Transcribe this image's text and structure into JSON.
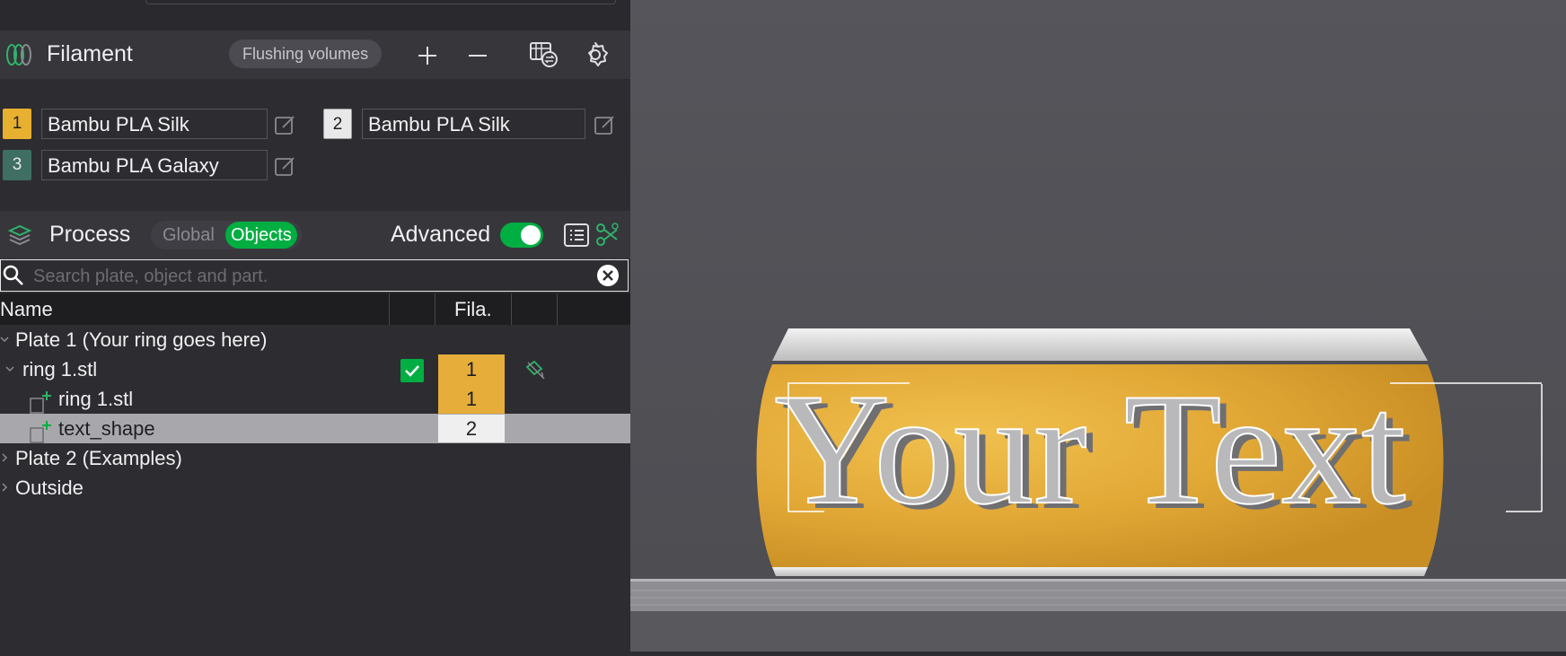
{
  "filament": {
    "title": "Filament",
    "flushing_label": "Flushing volumes",
    "items": [
      {
        "index": "1",
        "name": "Bambu PLA Silk",
        "color": "#e8b030"
      },
      {
        "index": "2",
        "name": "Bambu PLA Silk",
        "color": "#e8e8e8"
      },
      {
        "index": "3",
        "name": "Bambu PLA Galaxy",
        "color": "#3f6e62"
      }
    ]
  },
  "process": {
    "title": "Process",
    "global_label": "Global",
    "objects_label": "Objects",
    "advanced_label": "Advanced",
    "advanced_on": true
  },
  "search": {
    "placeholder": "Search plate, object and part."
  },
  "table": {
    "columns": [
      "Name",
      "Fila."
    ],
    "rows": [
      {
        "label": "Plate 1 (Your ring goes here)",
        "expanded": true
      },
      {
        "label": "ring 1.stl",
        "filament": "1",
        "checked": true,
        "expanded": true
      },
      {
        "label": "ring 1.stl",
        "filament": "1"
      },
      {
        "label": "text_shape",
        "filament": "2",
        "selected": true
      },
      {
        "label": "Plate 2 (Examples)",
        "expanded": false
      },
      {
        "label": "Outside",
        "expanded": false
      }
    ]
  },
  "viewport": {
    "model_text": "Your Text"
  },
  "colors": {
    "accent_green": "#00ae42",
    "panel_bg": "#2d2d31",
    "header_bg": "#36363b",
    "viewport_bg": "#55555b",
    "ring_gold": "#e6ad3a"
  }
}
